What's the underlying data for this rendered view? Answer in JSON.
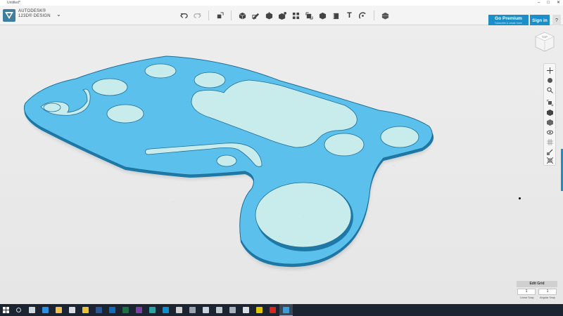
{
  "window": {
    "title": "Untitled*",
    "controls": [
      "–",
      "□",
      "✕"
    ]
  },
  "brand": {
    "line1": "AUTODESK®",
    "line2": "123D® DESIGN",
    "caret": "⌄"
  },
  "toolbar": {
    "undo_icon": "undo-icon",
    "redo_icon": "redo-icon",
    "tools": [
      "transform-icon",
      "primitives-icon",
      "sketch-icon",
      "construct-icon",
      "modify-icon",
      "pattern-icon",
      "grouping-icon",
      "combine-icon",
      "measure-icon",
      "text-icon",
      "snap-icon",
      "material-icon"
    ],
    "text_tool_glyph": "T"
  },
  "account": {
    "premium_label": "Go Premium",
    "premium_sub": "Subscribe & create more",
    "signin_label": "Sign in",
    "help_label": "?"
  },
  "navigation": {
    "buttons": [
      "pan-icon",
      "orbit-icon",
      "zoom-icon",
      "fit-icon",
      "view-solid-icon",
      "materials-view-icon",
      "visibility-icon",
      "grid-toggle-icon",
      "snap-to-icon",
      "hide-all-icon"
    ]
  },
  "grid": {
    "edit_label": "Edit Grid",
    "linear_snap_value": "1",
    "angular_snap_value": "1",
    "linear_snap_label": "Linear Snap",
    "angular_snap_label": "Angular Snap"
  },
  "taskbar": {
    "apps": [
      {
        "name": "search-icon",
        "color": "#cfd6de"
      },
      {
        "name": "task-view-icon",
        "color": "#cfd6de"
      },
      {
        "name": "edge-icon",
        "color": "#2f8fe0"
      },
      {
        "name": "file-explorer-icon",
        "color": "#f2c14e"
      },
      {
        "name": "store-icon",
        "color": "#d9dde3"
      },
      {
        "name": "chrome-icon",
        "color": "#e8c33a"
      },
      {
        "name": "word-icon",
        "color": "#2b5797"
      },
      {
        "name": "outlook-icon",
        "color": "#0f6cbd"
      },
      {
        "name": "excel-icon",
        "color": "#1e7145"
      },
      {
        "name": "onenote-icon",
        "color": "#7c3fa6"
      },
      {
        "name": "app-icon",
        "color": "#2aa3a3"
      },
      {
        "name": "photos-icon",
        "color": "#0a8fd1"
      },
      {
        "name": "calculator-icon",
        "color": "#d0d0d0"
      },
      {
        "name": "media-icon",
        "color": "#9aa3ad"
      },
      {
        "name": "paint-icon",
        "color": "#c9d2dc"
      },
      {
        "name": "tools-icon",
        "color": "#c0c7cf"
      },
      {
        "name": "keyboard-icon",
        "color": "#a8b1bb"
      },
      {
        "name": "plane-icon",
        "color": "#d8dde2"
      },
      {
        "name": "game-icon",
        "color": "#e2c400"
      },
      {
        "name": "acrobat-icon",
        "color": "#d8261c"
      },
      {
        "name": "123d-design-icon",
        "color": "#3e9bd6"
      }
    ]
  },
  "colors": {
    "plate_fill": "#5cc0ec",
    "plate_edge": "#1d6f98",
    "hole_fill": "#c8ecec",
    "accent": "#1a8fc9"
  }
}
